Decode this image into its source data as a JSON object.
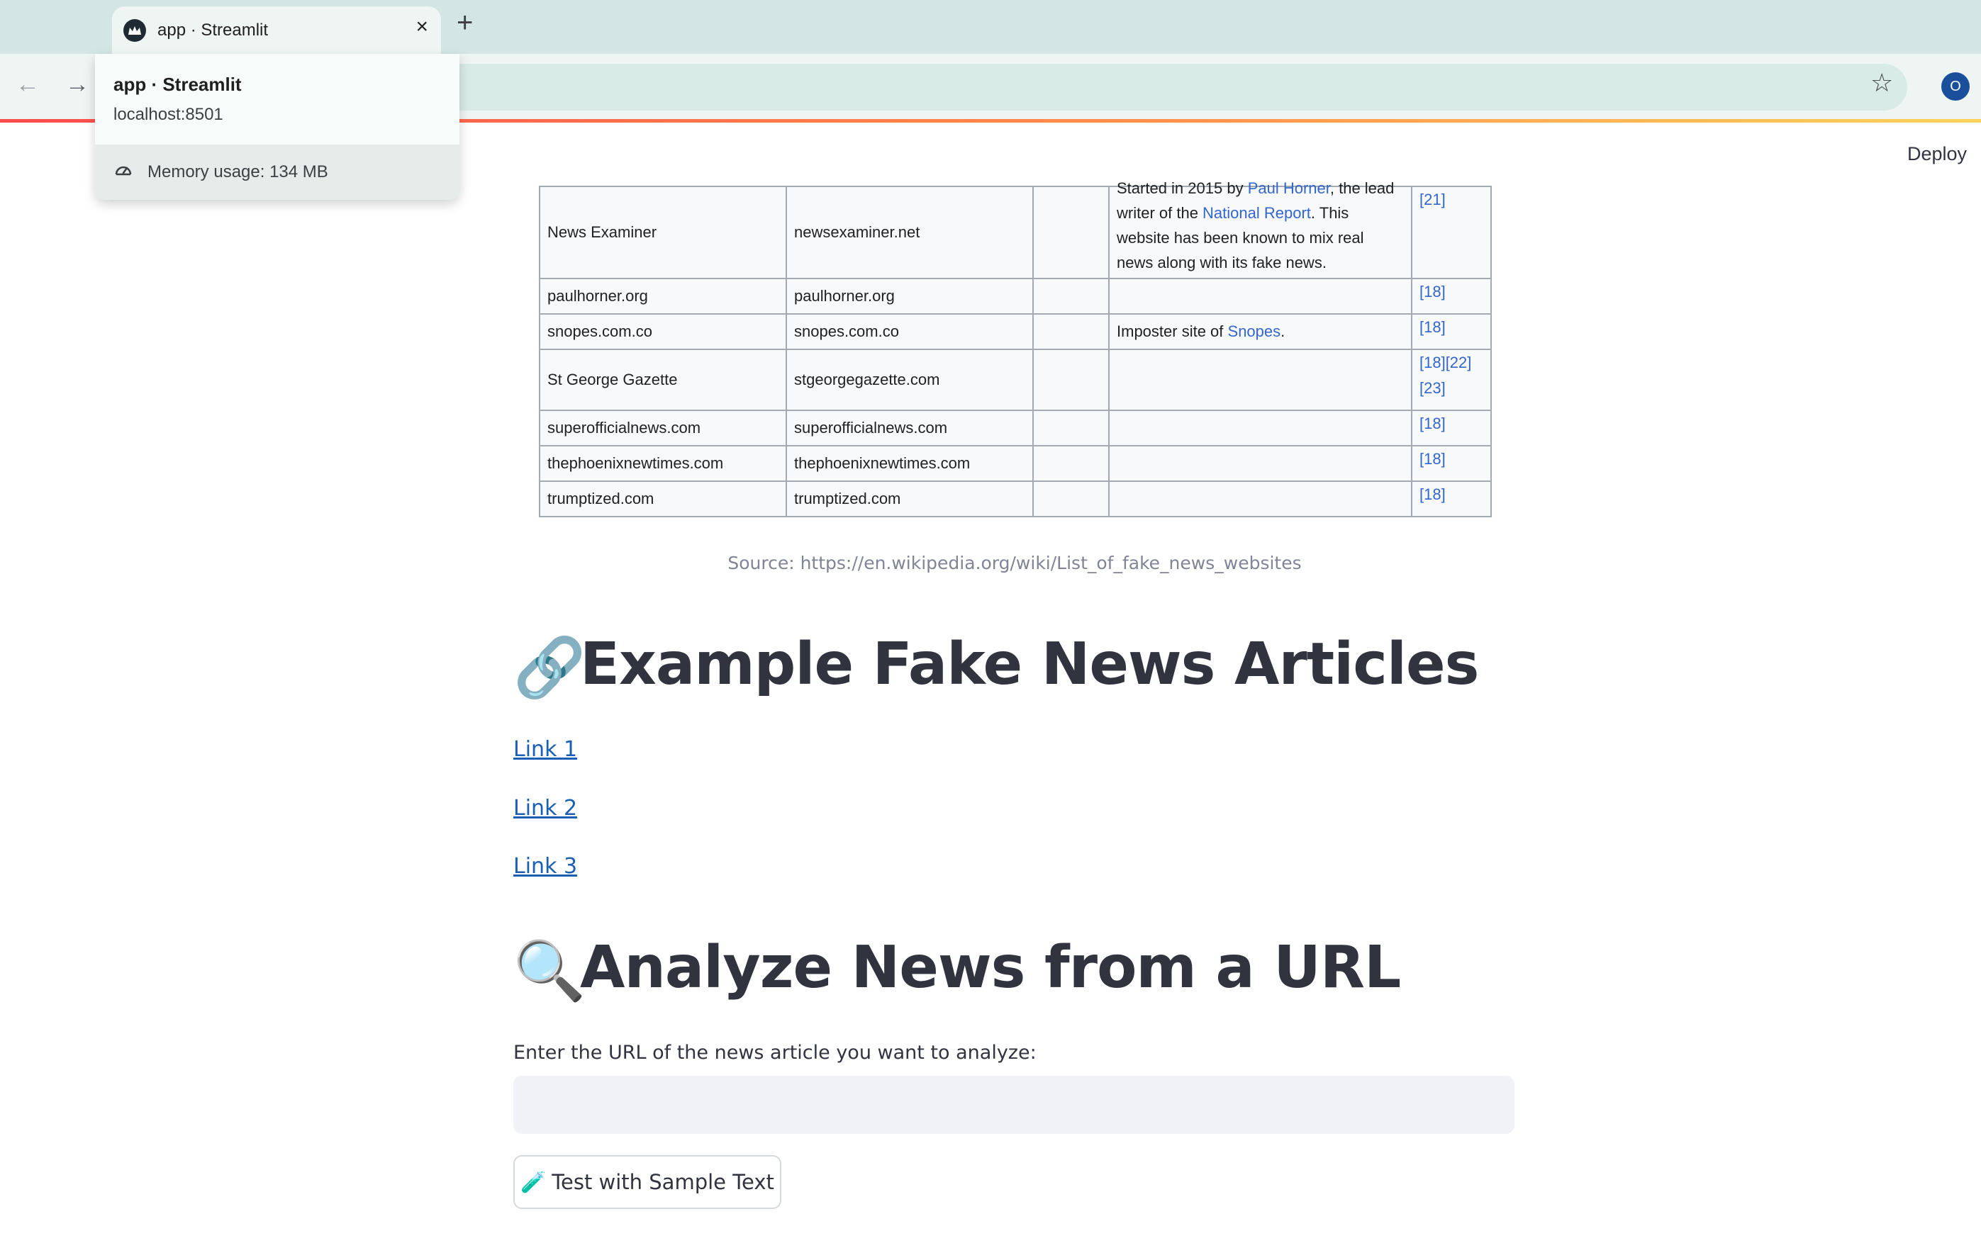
{
  "browser": {
    "tab_title": "app · Streamlit",
    "tab_close": "×",
    "new_tab": "+",
    "profile_initial": "O",
    "hover_card": {
      "title": "app · Streamlit",
      "url": "localhost:8501",
      "memory": "Memory usage: 134 MB"
    }
  },
  "app": {
    "deploy_label": "Deploy",
    "table_rows": [
      {
        "name": "News Examiner",
        "domain": "newsexaminer.net",
        "desc_parts": [
          "Started in 2015 by ",
          "Paul Horner",
          ", the lead writer of the ",
          "National Report",
          ". This website has been known to mix real news along with its fake news."
        ],
        "ref": "[21]"
      },
      {
        "name": "paulhorner.org",
        "domain": "paulhorner.org",
        "ref": "[18]"
      },
      {
        "name": "snopes.com.co",
        "domain": "snopes.com.co",
        "desc_parts": [
          "Imposter site of ",
          "Snopes",
          "."
        ],
        "ref": "[18]"
      },
      {
        "name": "St George Gazette",
        "domain": "stgeorgegazette.com",
        "ref": "[18][22][23]"
      },
      {
        "name": "superofficialnews.com",
        "domain": "superofficialnews.com",
        "ref": "[18]"
      },
      {
        "name": "thephoenixnewtimes.com",
        "domain": "thephoenixnewtimes.com",
        "ref": "[18]"
      },
      {
        "name": "trumptized.com",
        "domain": "trumptized.com",
        "ref": "[18]"
      }
    ],
    "caption": "Source: https://en.wikipedia.org/wiki/List_of_fake_news_websites",
    "examples_heading": "Example Fake News Articles",
    "examples_emoji": "🔗",
    "links": [
      "Link 1",
      "Link 2",
      "Link 3"
    ],
    "analyze_heading": "Analyze News from a URL",
    "analyze_emoji": "🔍",
    "url_label": "Enter the URL of the news article you want to analyze:",
    "url_value": "",
    "sample_button": "Test with Sample Text",
    "sample_emoji": "🧪"
  }
}
